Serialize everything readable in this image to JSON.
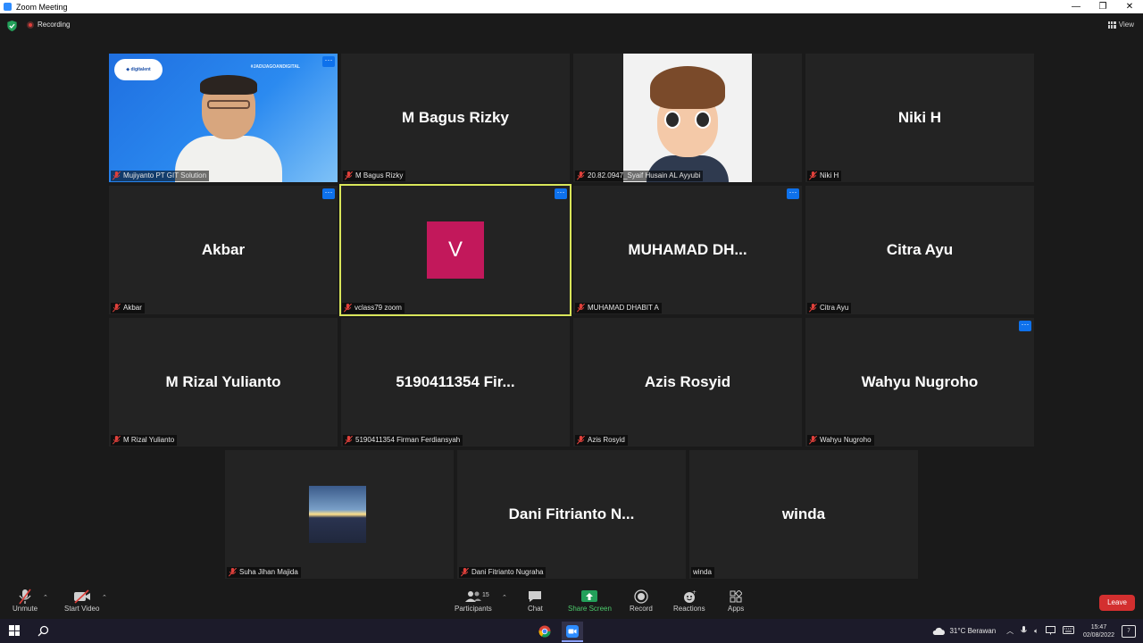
{
  "window": {
    "title": "Zoom Meeting"
  },
  "status": {
    "recording": "Recording",
    "view": "View"
  },
  "presenter": {
    "hashtag": "#JADIJAGOANDIGITAL"
  },
  "tiles": [
    {
      "big": "",
      "label": "Mujiyanto PT GIT Solution"
    },
    {
      "big": "M Bagus Rizky",
      "label": "M Bagus Rizky"
    },
    {
      "big": "",
      "label": "20.82.0947_Syaif Husain AL Ayyubi"
    },
    {
      "big": "Niki H",
      "label": "Niki H"
    },
    {
      "big": "Akbar",
      "label": "Akbar"
    },
    {
      "big": "V",
      "label": "vclass79 zoom"
    },
    {
      "big": "MUHAMAD  DH...",
      "label": "MUHAMAD DHABIT A"
    },
    {
      "big": "Citra Ayu",
      "label": "Citra Ayu"
    },
    {
      "big": "M Rizal Yulianto",
      "label": "M Rizal Yulianto"
    },
    {
      "big": "5190411354  Fir...",
      "label": "5190411354 Firman Ferdiansyah"
    },
    {
      "big": "Azis Rosyid",
      "label": "Azis Rosyid"
    },
    {
      "big": "Wahyu Nugroho",
      "label": "Wahyu Nugroho"
    },
    {
      "big": "",
      "label": "Suha Jihan Majida"
    },
    {
      "big": "Dani  Fitrianto  N...",
      "label": "Dani Fitrianto Nugraha"
    },
    {
      "big": "winda",
      "label": "winda"
    }
  ],
  "toolbar": {
    "unmute": "Unmute",
    "start_video": "Start Video",
    "participants": "Participants",
    "participant_count": "15",
    "chat": "Chat",
    "share_screen": "Share Screen",
    "record": "Record",
    "reactions": "Reactions",
    "apps": "Apps",
    "leave": "Leave"
  },
  "taskbar": {
    "weather": "31°C  Berawan",
    "time": "15:47",
    "date": "02/08/2022",
    "notifications": "7"
  },
  "colors": {
    "accent": "#0e71eb",
    "active_border": "#d9e65a",
    "share": "#4cc96b",
    "leave": "#d32f2f",
    "v_avatar": "#c2185b"
  }
}
